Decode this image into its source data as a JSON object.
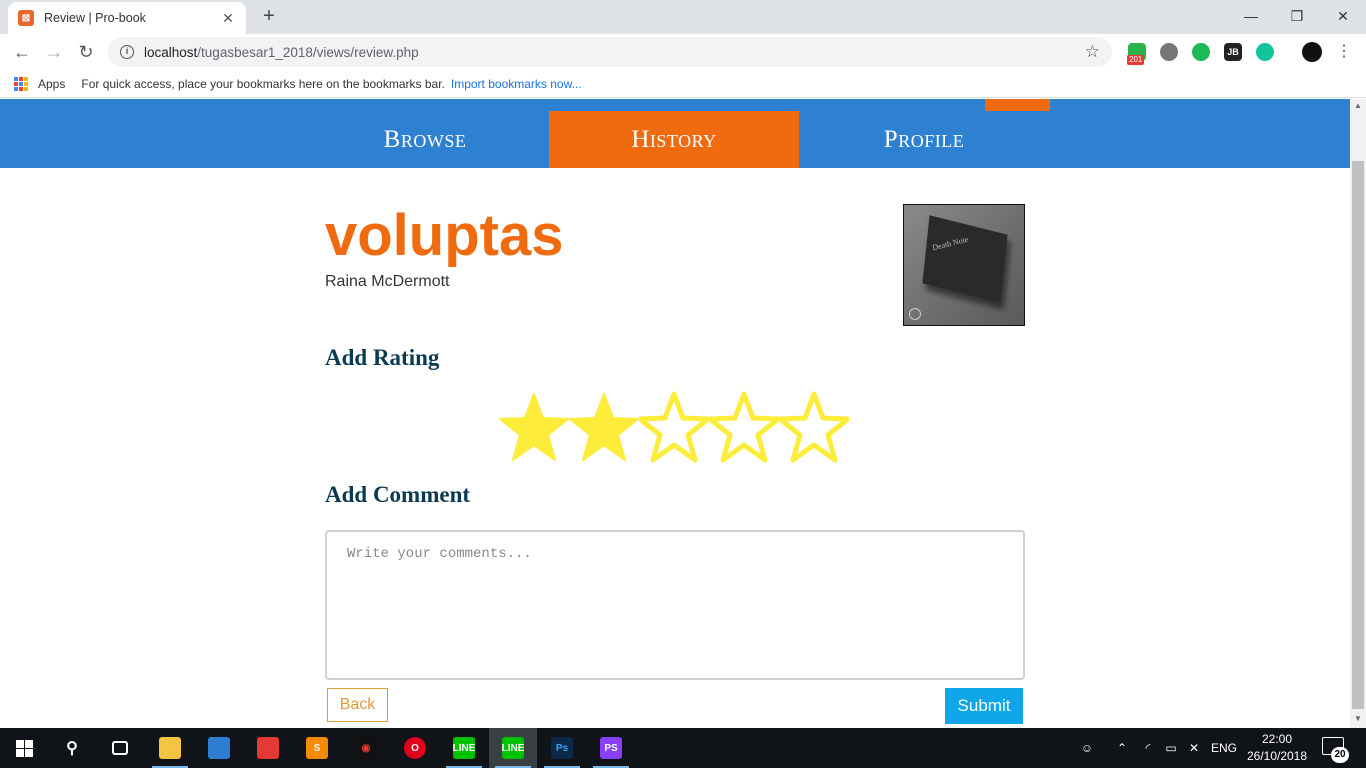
{
  "browser": {
    "tab_title": "Review | Pro-book",
    "tab_close": "✕",
    "new_tab": "+",
    "url_host": "localhost",
    "url_path": "/tugasbesar1_2018/views/review.php",
    "window_controls": {
      "minimize": "—",
      "restore": "❐",
      "close": "✕"
    },
    "extension_badge": "201",
    "extension_jb": "JB",
    "bookmarks_bar": {
      "apps_label": "Apps",
      "hint": "For quick access, place your bookmarks here on the bookmarks bar.",
      "import_link": "Import bookmarks now..."
    }
  },
  "nav": {
    "items": [
      {
        "label": "Browse",
        "active": false
      },
      {
        "label": "History",
        "active": true
      },
      {
        "label": "Profile",
        "active": false
      }
    ]
  },
  "book": {
    "title": "voluptas",
    "author": "Raina McDermott",
    "cover_text": "Death Note"
  },
  "rating": {
    "heading": "Add Rating",
    "max": 5,
    "value": 2,
    "color": "#fdec3a"
  },
  "comment": {
    "heading": "Add Comment",
    "placeholder": "Write your comments...",
    "value": ""
  },
  "actions": {
    "back_label": "Back",
    "submit_label": "Submit"
  },
  "colors": {
    "navbar": "#2e80d0",
    "accent": "#f06a0f",
    "heading": "#0c3a52",
    "submit": "#0ea5e9"
  },
  "taskbar": {
    "language": "ENG",
    "time": "22:00",
    "date": "26/10/2018",
    "notification_count": "20",
    "apps": [
      "start-icon",
      "search-icon",
      "task-view-icon",
      "file-explorer-icon",
      "store-icon",
      "gift-icon",
      "sublime-icon",
      "game-icon",
      "opera-icon",
      "line-icon",
      "line-icon",
      "photoshop-icon",
      "phpstorm-icon"
    ]
  }
}
